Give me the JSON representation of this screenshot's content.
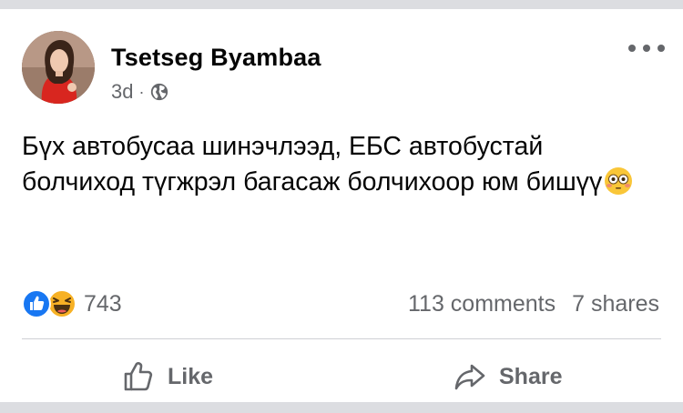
{
  "post": {
    "author": "Tsetseg Byambaa",
    "time": "3d",
    "separator": "·",
    "privacy_icon": "globe-icon",
    "text": "Бүх автобусаа шинэчлээд, ЕБС автобустай болчиход түгжрэл багасаж болчихоор юм бишүү",
    "emoji": "flushed-face-emoji"
  },
  "stats": {
    "reactions": [
      "like-reaction-icon",
      "haha-reaction-icon"
    ],
    "reaction_count": "743",
    "comments": "113 comments",
    "shares": "7 shares"
  },
  "actions": {
    "like_label": "Like",
    "share_label": "Share"
  },
  "colors": {
    "text": "#050505",
    "secondary": "#65676b",
    "like_blue": "#1877f2",
    "haha_yellow": "#f7b125",
    "divider": "#ced0d4",
    "background": "#dcdde1"
  }
}
